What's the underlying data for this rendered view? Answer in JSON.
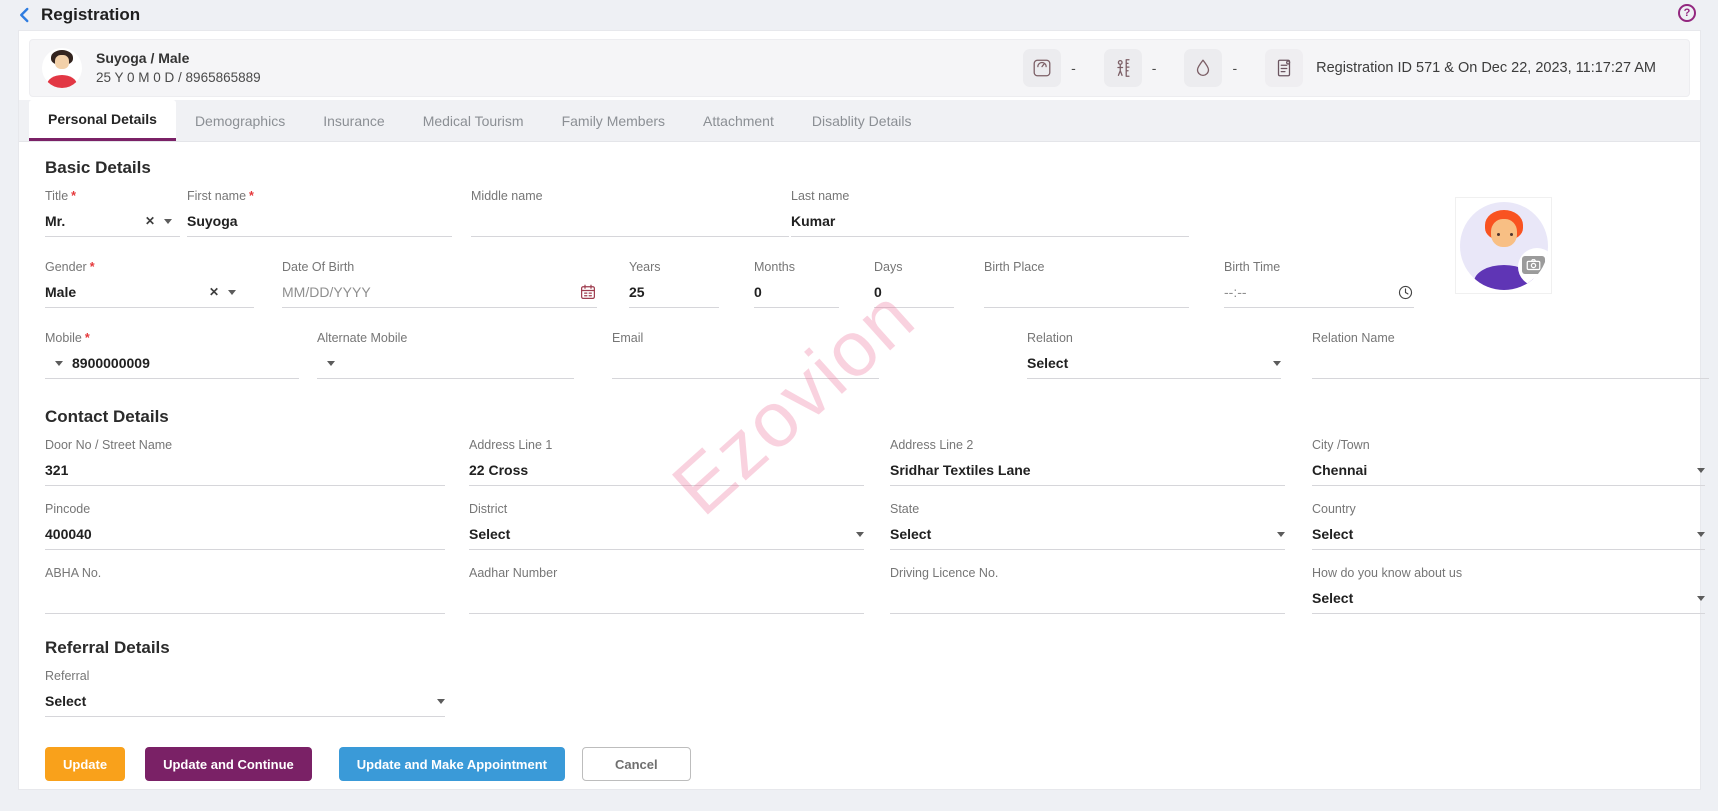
{
  "ui": {
    "required_marker": "*",
    "clear_glyph": "✕",
    "help_glyph": "?"
  },
  "header": {
    "title": "Registration"
  },
  "patient_bar": {
    "name": "Suyoga / Male",
    "meta": "25 Y 0 M 0 D / 8965865889",
    "vitals": [
      {
        "icon": "weight-scale-icon",
        "value": "-"
      },
      {
        "icon": "height-measure-icon",
        "value": "-"
      },
      {
        "icon": "blood-drop-icon",
        "value": "-"
      }
    ],
    "registration_info": "Registration ID 571 & On Dec 22, 2023, 11:17:27 AM"
  },
  "tabs": {
    "items": [
      {
        "label": "Personal Details",
        "active": true
      },
      {
        "label": "Demographics",
        "active": false
      },
      {
        "label": "Insurance",
        "active": false
      },
      {
        "label": "Medical Tourism",
        "active": false
      },
      {
        "label": "Family Members",
        "active": false
      },
      {
        "label": "Attachment",
        "active": false
      },
      {
        "label": "Disablity Details",
        "active": false
      }
    ]
  },
  "basic": {
    "heading": "Basic Details",
    "title": {
      "label": "Title",
      "value": "Mr."
    },
    "first_name": {
      "label": "First name",
      "value": "Suyoga"
    },
    "middle_name": {
      "label": "Middle name",
      "value": ""
    },
    "last_name": {
      "label": "Last name",
      "value": "Kumar"
    },
    "gender": {
      "label": "Gender",
      "value": "Male"
    },
    "dob": {
      "label": "Date Of Birth",
      "placeholder": "MM/DD/YYYY"
    },
    "years": {
      "label": "Years",
      "value": "25"
    },
    "months": {
      "label": "Months",
      "value": "0"
    },
    "days": {
      "label": "Days",
      "value": "0"
    },
    "birth_place": {
      "label": "Birth Place",
      "value": ""
    },
    "birth_time": {
      "label": "Birth Time",
      "placeholder": "--:--"
    },
    "mobile": {
      "label": "Mobile",
      "value": "8900000009"
    },
    "alternate_mobile": {
      "label": "Alternate Mobile",
      "value": ""
    },
    "email": {
      "label": "Email",
      "value": ""
    },
    "relation": {
      "label": "Relation",
      "value": "Select"
    },
    "relation_name": {
      "label": "Relation Name",
      "value": ""
    }
  },
  "contact": {
    "heading": "Contact Details",
    "door_no": {
      "label": "Door No / Street Name",
      "value": "321"
    },
    "address_line1": {
      "label": "Address Line 1",
      "value": "22 Cross"
    },
    "address_line2": {
      "label": "Address Line 2",
      "value": "Sridhar Textiles Lane"
    },
    "city": {
      "label": "City /Town",
      "value": "Chennai"
    },
    "pincode": {
      "label": "Pincode",
      "value": "400040"
    },
    "district": {
      "label": "District",
      "value": "Select"
    },
    "state": {
      "label": "State",
      "value": "Select"
    },
    "country": {
      "label": "Country",
      "value": "Select"
    },
    "abha": {
      "label": "ABHA No.",
      "value": ""
    },
    "aadhar": {
      "label": "Aadhar Number",
      "value": ""
    },
    "driving_licence": {
      "label": "Driving Licence No.",
      "value": ""
    },
    "referral_source": {
      "label": "How do you know about us",
      "value": "Select"
    }
  },
  "referral": {
    "heading": "Referral Details",
    "referral": {
      "label": "Referral",
      "value": "Select"
    }
  },
  "actions": {
    "update": "Update",
    "update_continue": "Update and Continue",
    "update_appointment": "Update and Make Appointment",
    "cancel": "Cancel"
  },
  "watermark": "Ezovion",
  "colors": {
    "accent_purple": "#7a2166",
    "accent_orange": "#f9a11b",
    "accent_blue": "#3a9ad8",
    "link_blue": "#2e7ce0",
    "required_red": "#e5383b",
    "watermark_pink": "#ee6e96"
  }
}
